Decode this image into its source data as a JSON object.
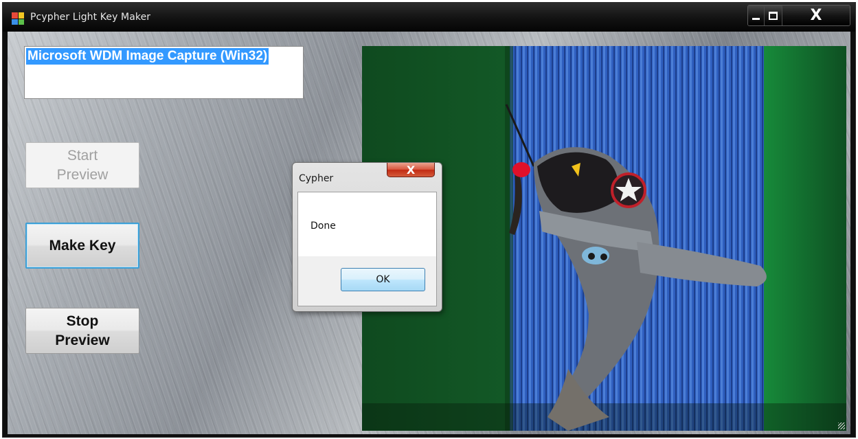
{
  "window": {
    "title": "Pcypher Light Key Maker",
    "caption": {
      "minimize": "▁",
      "maximize": "☐",
      "close": "X"
    }
  },
  "device_list": {
    "items": [
      "Microsoft WDM Image Capture (Win32)"
    ],
    "selected_index": 0
  },
  "buttons": {
    "start_preview": {
      "label": "Start\nPreview",
      "enabled": false
    },
    "make_key": {
      "label": "Make Key",
      "focused": true
    },
    "stop_preview": {
      "label": "Stop\nPreview"
    }
  },
  "dialog": {
    "title": "Cypher",
    "close_label": "X",
    "message": "Done",
    "ok_label": "OK"
  },
  "colors": {
    "selection": "#3399ff",
    "preview_green": "#1e7a3a",
    "preview_blue": "#2b58b8",
    "dialog_close_red": "#c22a14"
  }
}
